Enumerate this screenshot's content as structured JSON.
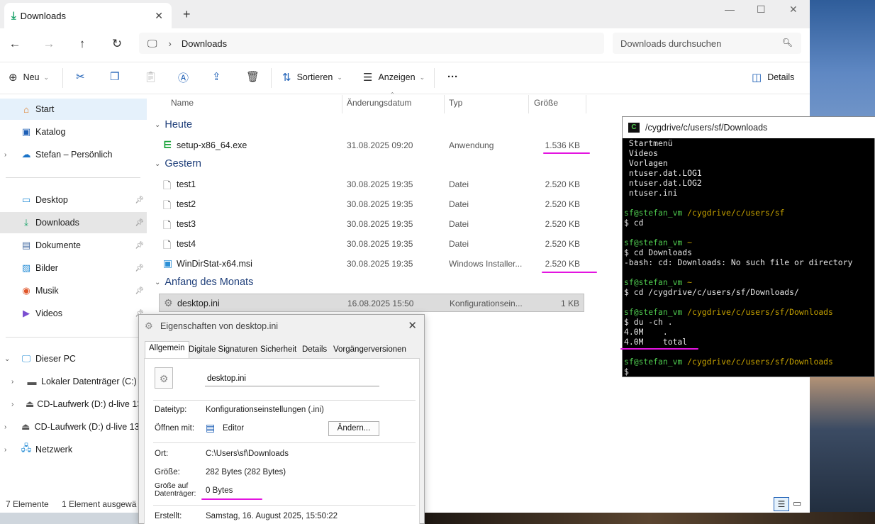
{
  "explorer": {
    "tab_title": "Downloads",
    "new_tab": "+",
    "address_path": "Downloads",
    "search_placeholder": "Downloads durchsuchen",
    "toolbar": {
      "new_label": "Neu",
      "sort_label": "Sortieren",
      "view_label": "Anzeigen",
      "more_label": "···",
      "details_label": "Details"
    },
    "nav": {
      "items": [
        {
          "label": "Start"
        },
        {
          "label": "Katalog"
        },
        {
          "label": "Stefan – Persönlich"
        },
        {
          "label": "Desktop"
        },
        {
          "label": "Downloads"
        },
        {
          "label": "Dokumente"
        },
        {
          "label": "Bilder"
        },
        {
          "label": "Musik"
        },
        {
          "label": "Videos"
        },
        {
          "label": "Dieser PC"
        },
        {
          "label": "Lokaler Datenträger (C:)"
        },
        {
          "label": "CD-Laufwerk (D:) d-live 13.0"
        },
        {
          "label": "CD-Laufwerk (D:) d-live 13.0"
        },
        {
          "label": "Netzwerk"
        }
      ]
    },
    "columns": {
      "name": "Name",
      "modified": "Änderungsdatum",
      "type": "Typ",
      "size": "Größe"
    },
    "groups": [
      {
        "label": "Heute"
      },
      {
        "label": "Gestern"
      },
      {
        "label": "Anfang des Monats"
      }
    ],
    "files": [
      {
        "name": "setup-x86_64.exe",
        "modified": "31.08.2025 09:20",
        "type": "Anwendung",
        "size": "1.536 KB"
      },
      {
        "name": "test1",
        "modified": "30.08.2025 19:35",
        "type": "Datei",
        "size": "2.520 KB"
      },
      {
        "name": "test2",
        "modified": "30.08.2025 19:35",
        "type": "Datei",
        "size": "2.520 KB"
      },
      {
        "name": "test3",
        "modified": "30.08.2025 19:35",
        "type": "Datei",
        "size": "2.520 KB"
      },
      {
        "name": "test4",
        "modified": "30.08.2025 19:35",
        "type": "Datei",
        "size": "2.520 KB"
      },
      {
        "name": "WinDirStat-x64.msi",
        "modified": "30.08.2025 19:35",
        "type": "Windows Installer...",
        "size": "2.520 KB"
      },
      {
        "name": "desktop.ini",
        "modified": "16.08.2025 15:50",
        "type": "Konfigurationsein...",
        "size": "1 KB"
      }
    ],
    "status": {
      "count": "7 Elemente",
      "selected": "1 Element ausgewä"
    }
  },
  "terminal": {
    "title": "/cygdrive/c/users/sf/Downloads",
    "lines": [
      {
        "prompt": "",
        "path": "",
        "text": " Startmenü"
      },
      {
        "prompt": "",
        "path": "",
        "text": " Videos"
      },
      {
        "prompt": "",
        "path": "",
        "text": " Vorlagen"
      },
      {
        "prompt": "",
        "path": "",
        "text": " ntuser.dat.LOG1"
      },
      {
        "prompt": "",
        "path": "",
        "text": " ntuser.dat.LOG2"
      },
      {
        "prompt": "",
        "path": "",
        "text": " ntuser.ini"
      },
      {
        "prompt": "",
        "path": "",
        "text": ""
      },
      {
        "prompt": "sf@stefan_vm",
        "path": " /cygdrive/c/users/sf",
        "text": ""
      },
      {
        "prompt": "",
        "path": "",
        "text": "$ cd"
      },
      {
        "prompt": "",
        "path": "",
        "text": ""
      },
      {
        "prompt": "sf@stefan_vm",
        "path": " ~",
        "text": ""
      },
      {
        "prompt": "",
        "path": "",
        "text": "$ cd Downloads"
      },
      {
        "prompt": "",
        "path": "",
        "text": "-bash: cd: Downloads: No such file or directory"
      },
      {
        "prompt": "",
        "path": "",
        "text": ""
      },
      {
        "prompt": "sf@stefan_vm",
        "path": " ~",
        "text": ""
      },
      {
        "prompt": "",
        "path": "",
        "text": "$ cd /cygdrive/c/users/sf/Downloads/"
      },
      {
        "prompt": "",
        "path": "",
        "text": ""
      },
      {
        "prompt": "sf@stefan_vm",
        "path": " /cygdrive/c/users/sf/Downloads",
        "text": ""
      },
      {
        "prompt": "",
        "path": "",
        "text": "$ du -ch ."
      },
      {
        "prompt": "",
        "path": "",
        "text": "4.0M    ."
      },
      {
        "prompt": "",
        "path": "",
        "text": "4.0M    total"
      },
      {
        "prompt": "",
        "path": "",
        "text": ""
      },
      {
        "prompt": "sf@stefan_vm",
        "path": " /cygdrive/c/users/sf/Downloads",
        "text": ""
      },
      {
        "prompt": "",
        "path": "",
        "text": "$"
      }
    ]
  },
  "dialog": {
    "title": "Eigenschaften von desktop.ini",
    "tabs": [
      {
        "label": "Allgemein"
      },
      {
        "label": "Digitale Signaturen"
      },
      {
        "label": "Sicherheit"
      },
      {
        "label": "Details"
      },
      {
        "label": "Vorgängerversionen"
      }
    ],
    "filename": "desktop.ini",
    "filetype_label": "Dateityp:",
    "filetype_value": "Konfigurationseinstellungen (.ini)",
    "opens_with_label": "Öffnen mit:",
    "opens_with_value": "Editor",
    "change_button": "Ändern...",
    "location_label": "Ort:",
    "location_value": "C:\\Users\\sf\\Downloads",
    "size_label": "Größe:",
    "size_value": "282 Bytes (282 Bytes)",
    "size_on_disk_label": "Größe auf Datenträger:",
    "size_on_disk_value": "0 Bytes",
    "created_label": "Erstellt:",
    "created_value": "Samstag, 16. August 2025, 15:50:22"
  },
  "colors": {
    "accent": "#1d5fb6",
    "highlight_pen": "#e314e0",
    "terminal_prompt": "#4ec94e",
    "terminal_path": "#c4a000"
  }
}
